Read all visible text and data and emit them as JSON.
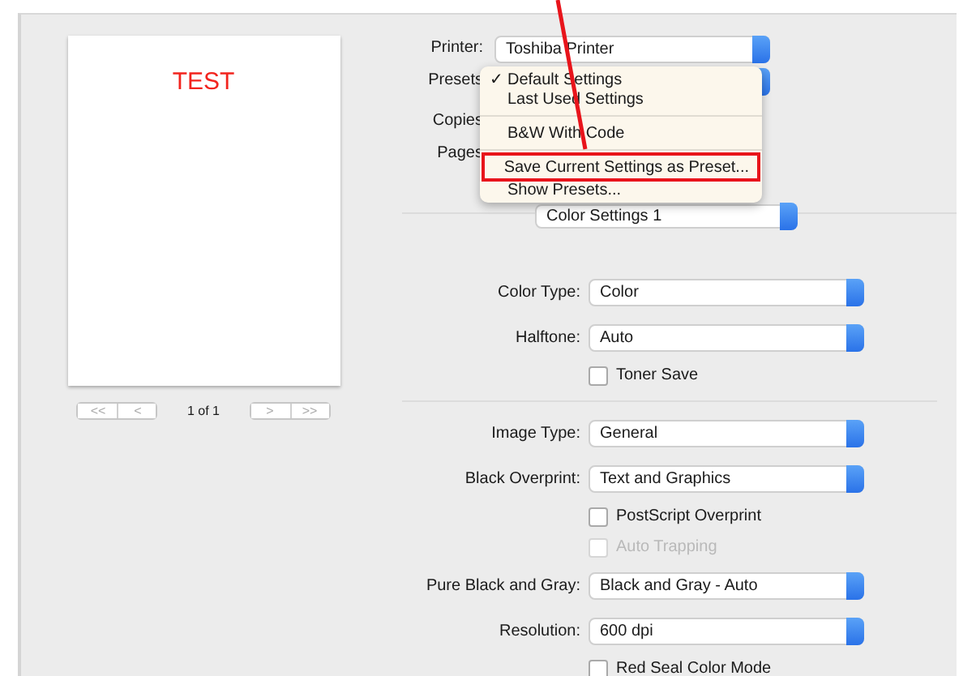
{
  "printer": {
    "label": "Printer:",
    "value": "Toshiba Printer"
  },
  "presets": {
    "label": "Presets",
    "check_glyph": "✓",
    "menu": [
      {
        "kind": "item",
        "label": "Default Settings",
        "checked": true,
        "outlined": false
      },
      {
        "kind": "item",
        "label": "Last Used Settings",
        "checked": false,
        "outlined": false
      },
      {
        "kind": "separator"
      },
      {
        "kind": "item",
        "label": "B&W With Code",
        "checked": false,
        "outlined": false
      },
      {
        "kind": "separator"
      },
      {
        "kind": "item",
        "label": "Save Current Settings as Preset...",
        "checked": false,
        "outlined": true
      },
      {
        "kind": "item",
        "label": "Show Presets...",
        "checked": false,
        "outlined": false
      }
    ]
  },
  "copies_label": "Copies",
  "pages_label": "Pages",
  "section_popup": {
    "value": "Color Settings 1"
  },
  "preview": {
    "page_text": "TEST",
    "page_indicator": "1 of 1",
    "nav_back": [
      "<<",
      "<"
    ],
    "nav_forward": [
      ">",
      ">>"
    ]
  },
  "settings": [
    {
      "kind": "popup",
      "label": "Color Type:",
      "value": "Color"
    },
    {
      "kind": "popup",
      "label": "Halftone:",
      "value": "Auto"
    },
    {
      "kind": "checkbox",
      "label": "Toner Save",
      "checked": false,
      "disabled": false
    },
    {
      "kind": "divider"
    },
    {
      "kind": "popup",
      "label": "Image Type:",
      "value": "General"
    },
    {
      "kind": "popup",
      "label": "Black Overprint:",
      "value": "Text and Graphics"
    },
    {
      "kind": "checkbox",
      "label": "PostScript Overprint",
      "checked": false,
      "disabled": false
    },
    {
      "kind": "checkbox",
      "label": "Auto Trapping",
      "checked": false,
      "disabled": true
    },
    {
      "kind": "popup",
      "label": "Pure Black and Gray:",
      "value": "Black and Gray - Auto"
    },
    {
      "kind": "popup",
      "label": "Resolution:",
      "value": "600 dpi"
    },
    {
      "kind": "checkbox",
      "label": "Red Seal Color Mode",
      "checked": false,
      "disabled": false
    }
  ]
}
